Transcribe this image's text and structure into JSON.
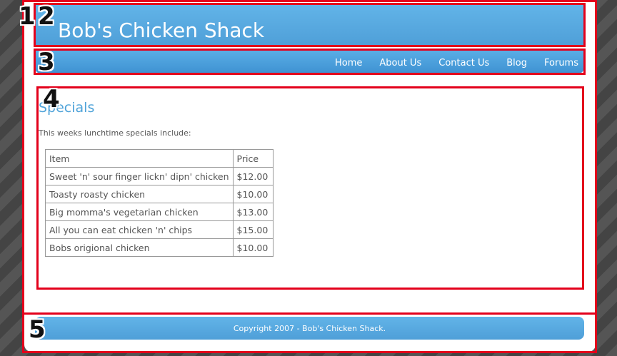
{
  "site": {
    "title": "Bob's Chicken Shack"
  },
  "nav": {
    "items": [
      {
        "label": "Home"
      },
      {
        "label": "About Us"
      },
      {
        "label": "Contact Us"
      },
      {
        "label": "Blog"
      },
      {
        "label": "Forums"
      }
    ]
  },
  "content": {
    "heading": "Specials",
    "intro": "This weeks lunchtime specials include:",
    "table": {
      "headers": [
        "Item",
        "Price"
      ],
      "rows": [
        [
          "Sweet 'n' sour finger lickn' dipn' chicken",
          "$12.00"
        ],
        [
          "Toasty roasty chicken",
          "$10.00"
        ],
        [
          "Big momma's vegetarian chicken",
          "$13.00"
        ],
        [
          "All you can eat chicken 'n' chips",
          "$15.00"
        ],
        [
          "Bobs origional chicken",
          "$10.00"
        ]
      ]
    }
  },
  "footer": {
    "copyright": "Copyright 2007 - Bob's Chicken Shack."
  },
  "annotations": {
    "labels": [
      "1",
      "2",
      "3",
      "4",
      "5"
    ]
  },
  "colors": {
    "accent_blue": "#4fa3d9",
    "annotation_red": "#e3001b"
  }
}
